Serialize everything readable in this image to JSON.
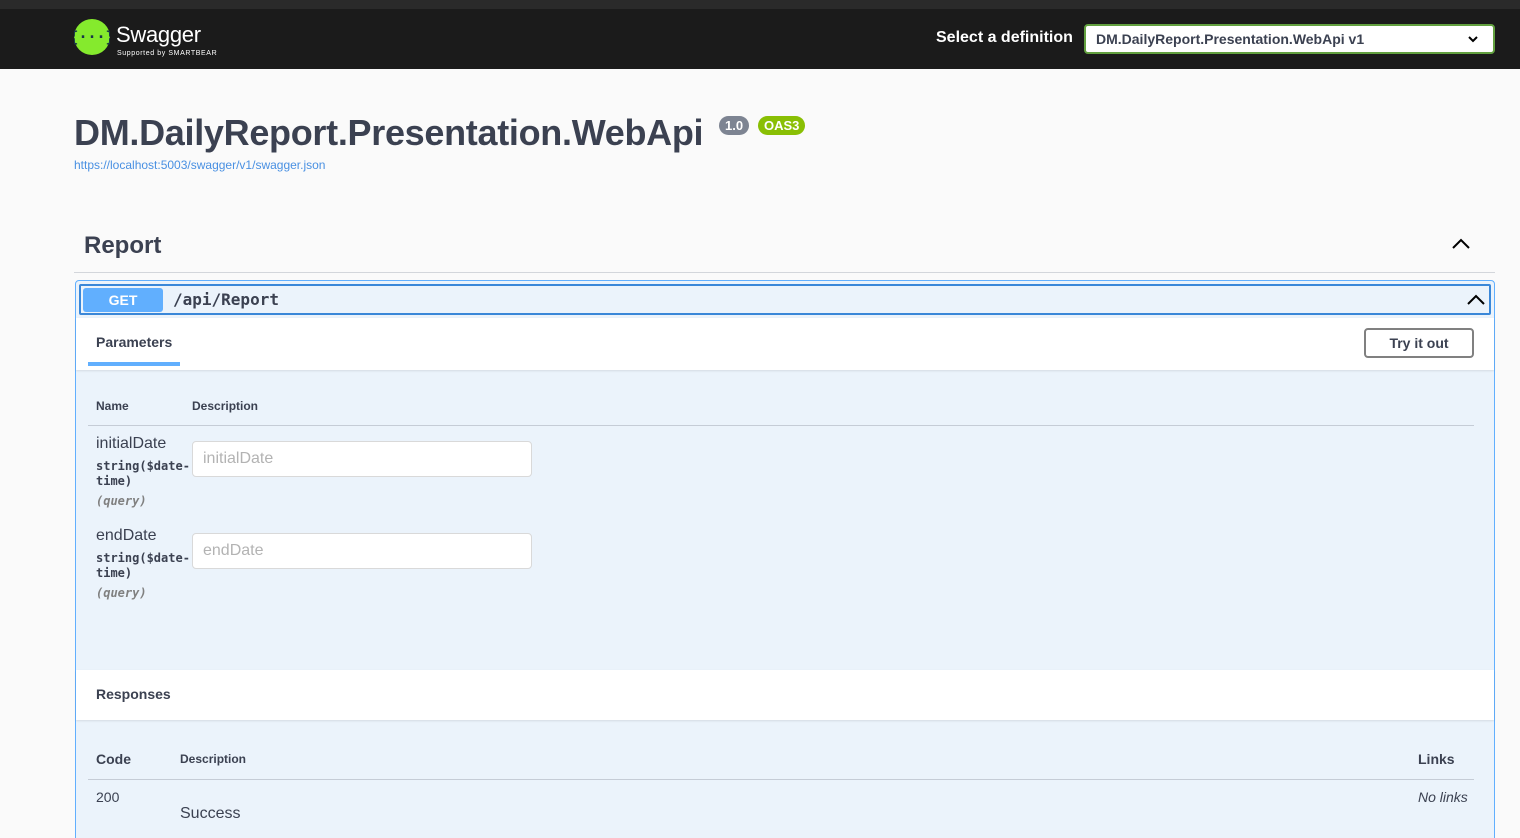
{
  "topbar": {
    "logo_text": "Swagger",
    "logo_sub": "Supported by SMARTBEAR",
    "select_label": "Select a definition",
    "select_value": "DM.DailyReport.Presentation.WebApi v1"
  },
  "info": {
    "title": "DM.DailyReport.Presentation.WebApi",
    "version": "1.0",
    "oas": "OAS3",
    "spec_url": "https://localhost:5003/swagger/v1/swagger.json"
  },
  "tag": {
    "name": "Report"
  },
  "operation": {
    "method": "GET",
    "path": "/api/Report",
    "params_tab": "Parameters",
    "try_label": "Try it out",
    "col_name": "Name",
    "col_description": "Description",
    "parameters": [
      {
        "name": "initialDate",
        "type_line1": "string($date-",
        "type_line2": "time)",
        "in": "(query)",
        "placeholder": "initialDate"
      },
      {
        "name": "endDate",
        "type_line1": "string($date-",
        "type_line2": "time)",
        "in": "(query)",
        "placeholder": "endDate"
      }
    ],
    "responses_title": "Responses",
    "resp_col_code": "Code",
    "resp_col_description": "Description",
    "resp_col_links": "Links",
    "responses": [
      {
        "code": "200",
        "description": "Success",
        "links": "No links"
      }
    ]
  },
  "colors": {
    "get": "#61affe",
    "accent": "#85ea2d",
    "oas_badge": "#89bf04",
    "version_badge": "#7d8492"
  }
}
